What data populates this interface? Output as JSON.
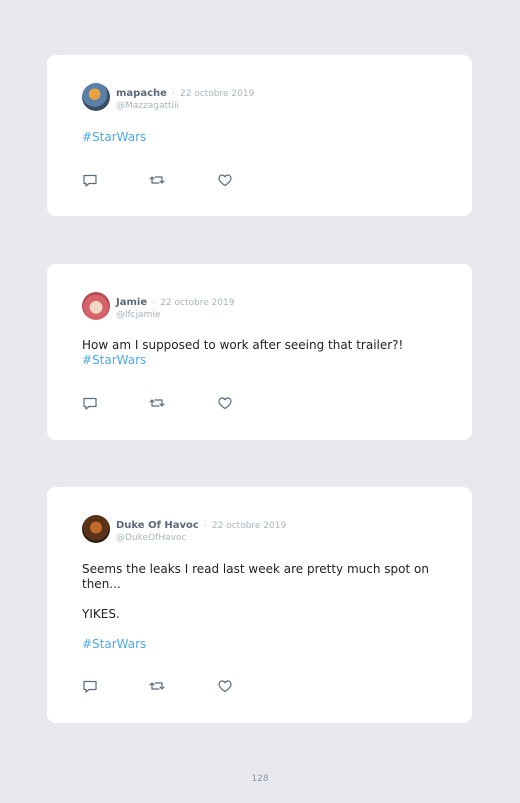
{
  "tweets": [
    {
      "name": "mapache",
      "date": "22 octobre 2019",
      "handle": "@Mazzagattiii",
      "text_lines": [],
      "hashtag": "#StarWars"
    },
    {
      "name": "Jamie",
      "date": "22 octobre 2019",
      "handle": "@lfcjamie",
      "text_lines": [
        "How am I supposed to work after seeing that trailer?!"
      ],
      "hashtag": "#StarWars"
    },
    {
      "name": "Duke Of Havoc",
      "date": "22 octobre 2019",
      "handle": "@DukeOfHavoc",
      "text_lines": [
        "Seems the leaks I read last week are pretty much spot on then...",
        "YIKES."
      ],
      "hashtag": "#StarWars"
    }
  ],
  "separator": "·",
  "page_number": "128",
  "colors": {
    "background": "#e8e8ee",
    "card": "#ffffff",
    "hashtag": "#4aabe8",
    "name": "#5a6a7a",
    "muted": "#a8b4bd"
  },
  "icons": [
    "reply-icon",
    "retweet-icon",
    "like-icon"
  ]
}
